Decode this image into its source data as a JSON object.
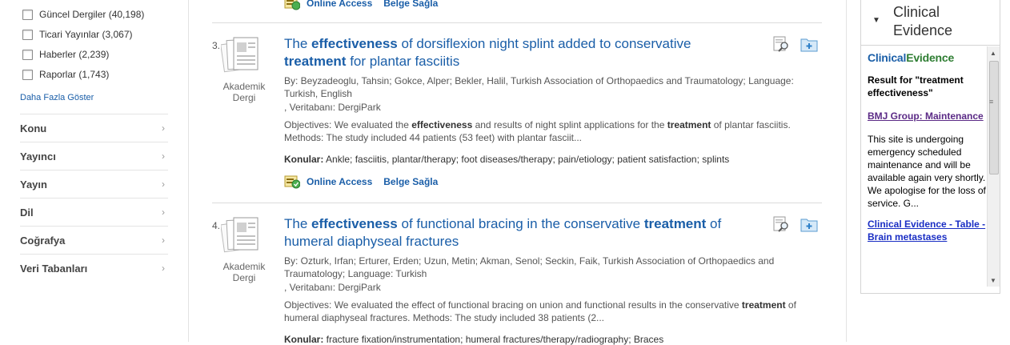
{
  "filters": {
    "checkboxes": [
      {
        "label": "Güncel Dergiler (40,198)"
      },
      {
        "label": "Ticari Yayınlar (3,067)"
      },
      {
        "label": "Haberler (2,239)"
      },
      {
        "label": "Raporlar (1,743)"
      }
    ],
    "more_label": "Daha Fazla Göster",
    "facets": [
      {
        "label": "Konu"
      },
      {
        "label": "Yayıncı"
      },
      {
        "label": "Yayın"
      },
      {
        "label": "Dil"
      },
      {
        "label": "Coğrafya"
      },
      {
        "label": "Veri Tabanları"
      }
    ]
  },
  "top_links": {
    "online": "Online Access",
    "belge": "Belge Sağla"
  },
  "results": [
    {
      "num": "3.",
      "type_line1": "Akademik",
      "type_line2": "Dergi",
      "title_pre": "The ",
      "title_b1": "effectiveness",
      "title_mid": " of dorsiflexion night splint added to conservative ",
      "title_b2": "treatment",
      "title_post": " for plantar fasciitis",
      "meta": "By: Beyzadeoglu, Tahsin; Gokce, Alper; Bekler, Halil, Turkish Association of Orthopaedics and Traumatology; Language: Turkish, English",
      "database": ", Veritabanı: DergiPark",
      "abs_1": "Objectives: We evaluated the ",
      "abs_b1": "effectiveness",
      "abs_2": " and results of night splint applications for the ",
      "abs_b2": "treatment",
      "abs_3": " of plantar fasciitis. Methods: The study included 44 patients (53 feet) with plantar fasciit...",
      "subjects_label": "Konular:",
      "subjects": " Ankle; fasciitis, plantar/therapy; foot diseases/therapy; pain/etiology; patient satisfaction; splints",
      "online": "Online Access",
      "belge": "Belge Sağla"
    },
    {
      "num": "4.",
      "type_line1": "Akademik",
      "type_line2": "Dergi",
      "title_pre": "The ",
      "title_b1": "effectiveness",
      "title_mid": " of functional bracing in the conservative ",
      "title_b2": "treatment",
      "title_post": " of humeral diaphyseal fractures",
      "meta": "By: Ozturk, Irfan; Erturer, Erden; Uzun, Metin; Akman, Senol; Seckin, Faik, Turkish Association of Orthopaedics and Traumatology; Language: Turkish",
      "database": ", Veritabanı: DergiPark",
      "abs_1": "Objectives: We evaluated the effect of functional bracing on union and functional results in the conservative ",
      "abs_b2": "treatment",
      "abs_3": " of humeral diaphyseal fractures. Methods: The study included 38 patients (2...",
      "subjects_label": "Konular:",
      "subjects": " fracture fixation/instrumentation; humeral fractures/therapy/radiography; Braces"
    }
  ],
  "widget": {
    "title": "Clinical Evidence",
    "logo_a": "Clinical",
    "logo_b": "Evidence",
    "result_for": "Result for \"treatment effectiveness\"",
    "link1": "BMJ Group: Maintenance",
    "text": "This site is undergoing emergency scheduled maintenance and will be available again very shortly. We apologise for the loss of service. G...",
    "link2": "Clinical Evidence - Table - Brain metastases"
  },
  "colors": {
    "link": "#1a5ea8",
    "visited": "#5b2a86",
    "accent_green": "#2e7d32"
  }
}
